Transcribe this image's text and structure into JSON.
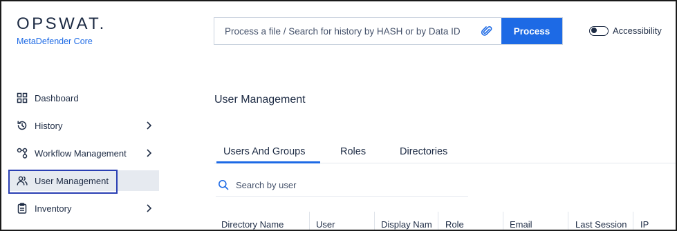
{
  "brand": {
    "name": "OPSWAT.",
    "product": "MetaDefender Core"
  },
  "process": {
    "placeholder": "Process a file / Search for history by HASH or by Data ID",
    "button_label": "Process",
    "attach_icon": "paperclip-icon"
  },
  "accessibility": {
    "label": "Accessibility",
    "enabled": false
  },
  "sidebar": {
    "items": [
      {
        "label": "Dashboard",
        "icon": "grid-icon",
        "has_submenu": false,
        "active": false
      },
      {
        "label": "History",
        "icon": "history-icon",
        "has_submenu": true,
        "active": false
      },
      {
        "label": "Workflow Management",
        "icon": "workflow-icon",
        "has_submenu": true,
        "active": false
      },
      {
        "label": "User Management",
        "icon": "users-icon",
        "has_submenu": false,
        "active": true
      },
      {
        "label": "Inventory",
        "icon": "clipboard-icon",
        "has_submenu": true,
        "active": false
      }
    ]
  },
  "main": {
    "title": "User Management",
    "tabs": [
      {
        "label": "Users And Groups",
        "active": true
      },
      {
        "label": "Roles",
        "active": false
      },
      {
        "label": "Directories",
        "active": false
      }
    ],
    "search": {
      "placeholder": "Search by user"
    },
    "table": {
      "columns": [
        "Directory Name",
        "User",
        "Display Nam",
        "Role",
        "Email",
        "Last Session",
        "IP"
      ]
    }
  },
  "colors": {
    "accent": "#1d6ae5",
    "text": "#1d2b44",
    "active_bg": "#e6eaf0",
    "highlight_border": "#2a3fb3"
  }
}
